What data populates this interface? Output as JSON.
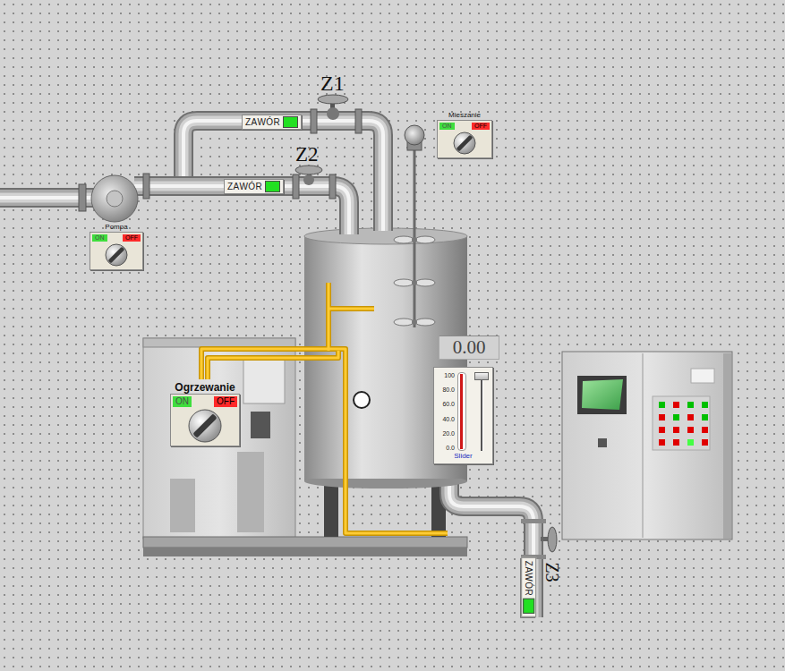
{
  "valves": [
    {
      "name": "Z1",
      "label": "ZAWÓR",
      "open": true,
      "kind": "horizontal"
    },
    {
      "name": "Z2",
      "label": "ZAWÓR",
      "open": true,
      "kind": "horizontal"
    },
    {
      "name": "Z3",
      "label": "ZAWÓR",
      "open": true,
      "kind": "vertical"
    }
  ],
  "switches": [
    {
      "name": "Pompa",
      "on_label": "ON",
      "off_label": "OFF",
      "on": false,
      "kind": "small"
    },
    {
      "name": "Mieszanie",
      "on_label": "ON",
      "off_label": "OFF",
      "on": false,
      "kind": "small"
    },
    {
      "name": "Ogrzewanie",
      "on_label": "ON",
      "off_label": "OFF",
      "on": false,
      "kind": "large"
    }
  ],
  "display": {
    "value": "0.00"
  },
  "slider": {
    "label": "Slider",
    "ticks": [
      "100",
      "80.0",
      "60.0",
      "40.0",
      "20.0",
      "0.0"
    ],
    "level": 1
  },
  "cabinet": {
    "lamps": [
      {
        "color": "#00c000"
      },
      {
        "color": "#e00000"
      },
      {
        "color": "#00c000"
      },
      {
        "color": "#00c000"
      },
      {
        "color": "#e00000"
      },
      {
        "color": "#00c000"
      },
      {
        "color": "#e00000"
      },
      {
        "color": "#00c000"
      },
      {
        "color": "#e00000"
      },
      {
        "color": "#e00000"
      },
      {
        "color": "#e00000"
      },
      {
        "color": "#e00000"
      },
      {
        "color": "#e00000"
      },
      {
        "color": "#e00000"
      },
      {
        "color": "#44ff44"
      },
      {
        "color": "#e00000"
      }
    ]
  }
}
